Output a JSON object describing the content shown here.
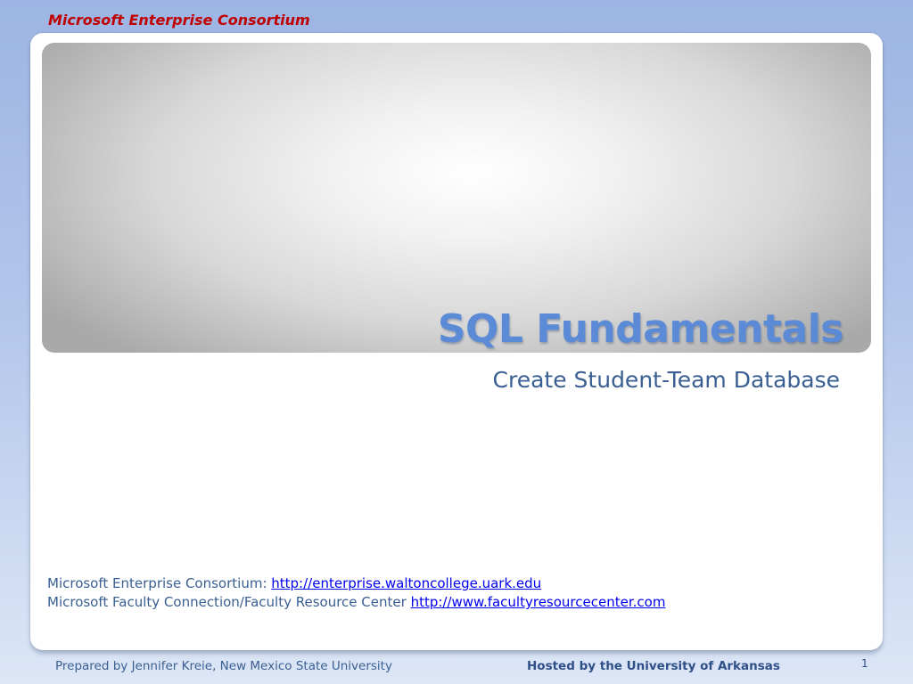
{
  "header": {
    "brand": "Microsoft Enterprise Consortium"
  },
  "slide": {
    "title": "SQL Fundamentals",
    "subtitle": "Create Student-Team Database",
    "links": [
      {
        "label": "Microsoft Enterprise Consortium: ",
        "url_text": "http://enterprise.waltoncollege.uark.edu"
      },
      {
        "label": "Microsoft Faculty Connection/Faculty Resource Center ",
        "url_text": "http://www.facultyresourcecenter.com"
      }
    ]
  },
  "footer": {
    "prepared_by": "Prepared by Jennifer Kreie, New Mexico State University",
    "hosted_by": "Hosted by the University of Arkansas",
    "slide_number": "1"
  },
  "colors": {
    "brand_red": "#c00000",
    "title_blue": "#5b8ad6",
    "text_blue": "#3a5f92",
    "link_blue": "#0000ee"
  }
}
